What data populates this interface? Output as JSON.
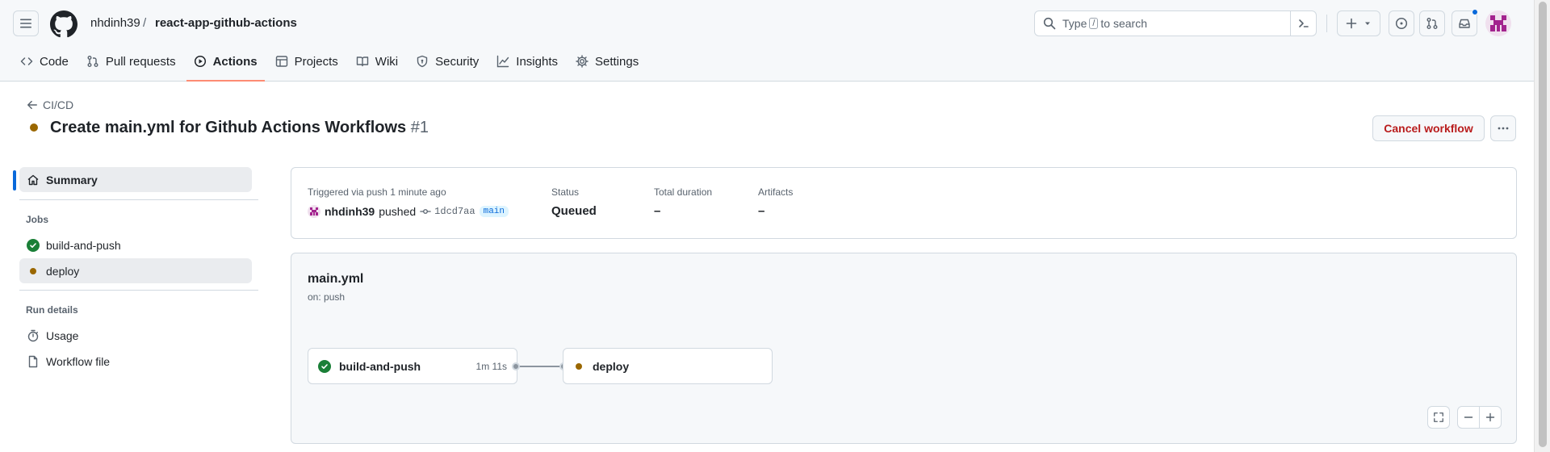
{
  "header": {
    "owner": "nhdinh39",
    "separator": "/",
    "repo": "react-app-github-actions",
    "search": {
      "prefix": "Type",
      "key": "/",
      "suffix": "to search"
    }
  },
  "tabs": [
    {
      "label": "Code",
      "icon": "code-icon"
    },
    {
      "label": "Pull requests",
      "icon": "pull-request-icon"
    },
    {
      "label": "Actions",
      "icon": "play-icon",
      "active": true
    },
    {
      "label": "Projects",
      "icon": "table-icon"
    },
    {
      "label": "Wiki",
      "icon": "book-icon"
    },
    {
      "label": "Security",
      "icon": "shield-icon"
    },
    {
      "label": "Insights",
      "icon": "graph-icon"
    },
    {
      "label": "Settings",
      "icon": "gear-icon"
    }
  ],
  "run": {
    "back_label": "CI/CD",
    "title": "Create main.yml for Github Actions Workflows",
    "number": "#1",
    "cancel_label": "Cancel workflow"
  },
  "sidebar": {
    "summary_label": "Summary",
    "jobs_heading": "Jobs",
    "jobs": [
      {
        "label": "build-and-push",
        "status": "success"
      },
      {
        "label": "deploy",
        "status": "queued"
      }
    ],
    "run_details_heading": "Run details",
    "usage_label": "Usage",
    "workflow_file_label": "Workflow file"
  },
  "summary": {
    "trigger_text": "Triggered via push 1 minute ago",
    "actor": "nhdinh39",
    "action": "pushed",
    "commit": "1dcd7aa",
    "branch": "main",
    "status_label": "Status",
    "status_value": "Queued",
    "duration_label": "Total duration",
    "duration_value": "–",
    "artifacts_label": "Artifacts",
    "artifacts_value": "–"
  },
  "workflow": {
    "file": "main.yml",
    "trigger": "on: push",
    "jobs": [
      {
        "name": "build-and-push",
        "duration": "1m 11s",
        "status": "success"
      },
      {
        "name": "deploy",
        "duration": "",
        "status": "queued"
      }
    ]
  },
  "colors": {
    "accent_tab": "#fd8c73",
    "success": "#1a7f37",
    "queued": "#9a6700",
    "link": "#0969da",
    "danger": "#b91c1c"
  }
}
